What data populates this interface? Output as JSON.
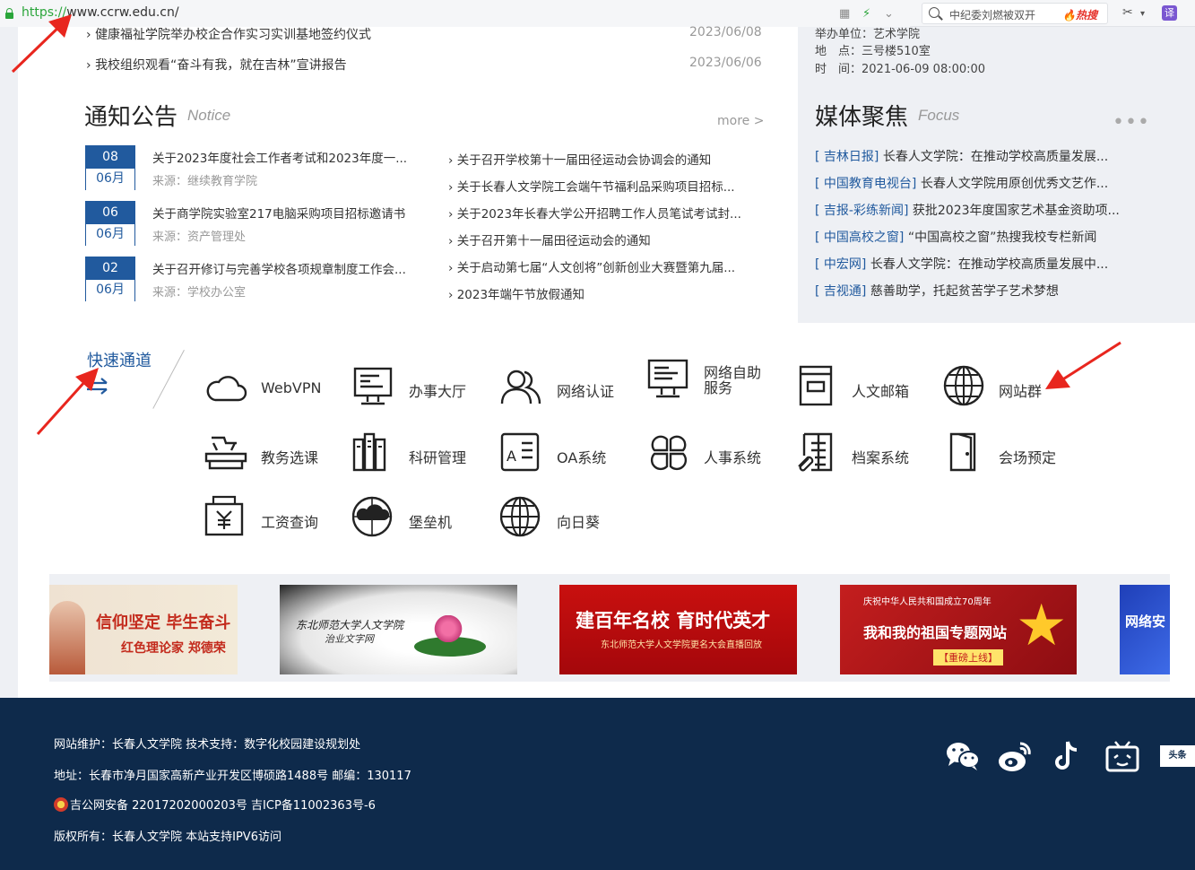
{
  "browser": {
    "url_scheme": "https://",
    "url_rest": "www.ccrw.edu.cn/",
    "search_query": "中纪委刘燃被双开",
    "hot_label": "🔥热搜",
    "translate_label": "译"
  },
  "news": [
    {
      "title": "健康福祉学院举办校企合作实习实训基地签约仪式",
      "date": "2023/06/08"
    },
    {
      "title": "我校组织观看“奋斗有我，就在吉林”宣讲报告",
      "date": "2023/06/06"
    }
  ],
  "notice": {
    "title": "通知公告",
    "subtitle": "Notice",
    "more": "more >",
    "source_prefix": "来源：",
    "left_items": [
      {
        "day": "08",
        "month": "06月",
        "title": "关于2023年度社会工作者考试和2023年度一...",
        "source": "继续教育学院"
      },
      {
        "day": "06",
        "month": "06月",
        "title": "关于商学院实验室217电脑采购项目招标邀请书",
        "source": "资产管理处"
      },
      {
        "day": "02",
        "month": "06月",
        "title": "关于召开修订与完善学校各项规章制度工作会...",
        "source": "学校办公室"
      }
    ],
    "right_items": [
      "关于召开学校第十一届田径运动会协调会的通知",
      "关于长春人文学院工会端午节福利品采购项目招标...",
      "关于2023年长春大学公开招聘工作人员笔试考试封...",
      "关于召开第十一届田径运动会的通知",
      "关于启动第七届“人文创将”创新创业大赛暨第九届...",
      "2023年端午节放假通知"
    ]
  },
  "event": {
    "unit": "举办单位：艺术学院",
    "place": "地　点：三号楼510室",
    "time": "时　间：2021-06-09 08:00:00"
  },
  "media": {
    "title": "媒体聚焦",
    "subtitle": "Focus",
    "more_dots": "•••",
    "items": [
      {
        "src": "[ 吉林日报]",
        "title": "长春人文学院：在推动学校高质量发展..."
      },
      {
        "src": "[ 中国教育电视台]",
        "title": "长春人文学院用原创优秀文艺作..."
      },
      {
        "src": "[ 吉报-彩练新闻]",
        "title": "获批2023年度国家艺术基金资助项..."
      },
      {
        "src": "[ 中国高校之窗]",
        "title": "“中国高校之窗”热搜我校专栏新闻"
      },
      {
        "src": "[ 中宏网]",
        "title": "长春人文学院：在推动学校高质量发展中..."
      },
      {
        "src": "[ 吉视通]",
        "title": "慈善助学，托起贫苦学子艺术梦想"
      }
    ]
  },
  "quick": {
    "title": "快速通道",
    "items": [
      {
        "label": "WebVPN",
        "icon": "cloud-icon"
      },
      {
        "label": "办事大厅",
        "icon": "monitor-icon"
      },
      {
        "label": "网络认证",
        "icon": "users-icon"
      },
      {
        "label": "网络自助\n服务",
        "icon": "monitor-service-icon"
      },
      {
        "label": "人文邮箱",
        "icon": "mailbox-icon"
      },
      {
        "label": "网站群",
        "icon": "globe-icon"
      },
      {
        "label": "教务选课",
        "icon": "desk-icon"
      },
      {
        "label": "科研管理",
        "icon": "books-icon"
      },
      {
        "label": "OA系统",
        "icon": "oa-icon"
      },
      {
        "label": "人事系统",
        "icon": "grid-icon"
      },
      {
        "label": "档案系统",
        "icon": "archive-icon"
      },
      {
        "label": "会场预定",
        "icon": "door-icon"
      },
      {
        "label": "工资查询",
        "icon": "salary-icon"
      },
      {
        "label": "堡垒机",
        "icon": "cloud-shield-icon"
      },
      {
        "label": "向日葵",
        "icon": "globe-icon"
      }
    ]
  },
  "banners": {
    "b1_main": "信仰坚定 毕生奋斗",
    "b1_sub": "红色理论家 郑德荣",
    "b2_main": "东北师范大学人文学院",
    "b2_sub": "治业文字网",
    "b3_main": "建百年名校 育时代英才",
    "b3_sub": "东北师范大学人文学院更名大会直播回放",
    "b4_top": "庆祝中华人民共和国成立70周年",
    "b4_main": "我和我的祖国专题网站",
    "b4_sub": "【重磅上线】",
    "b5_main": "网络安"
  },
  "footer": {
    "maintain": "网站维护：长春人文学院  技术支持：数字化校园建设规划处",
    "address": "地址：长春市净月国家高新产业开发区博硕路1488号 邮编：130117",
    "icp": "吉公网安备 22017202000203号  吉ICP备11002363号-6",
    "copyright": "版权所有：长春人文学院    本站支持IPV6访问",
    "toutiao": "头条"
  },
  "colors": {
    "accent": "#215a9e",
    "footer_bg": "#0e2a4b",
    "arrow": "#e8261e"
  }
}
